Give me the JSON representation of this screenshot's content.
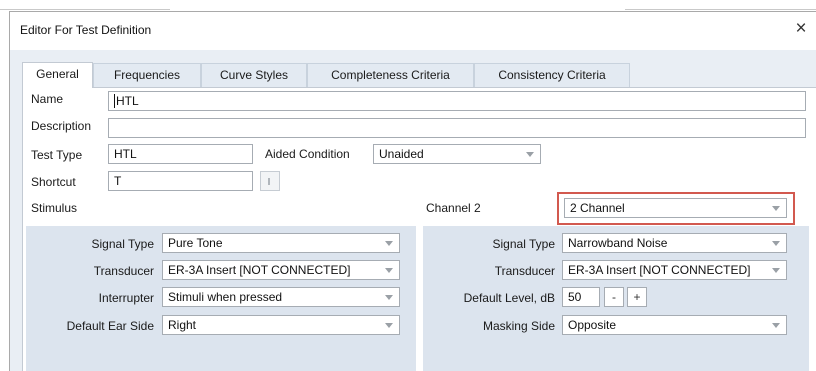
{
  "window": {
    "title": "Editor For Test Definition",
    "close_glyph": "×"
  },
  "tabs": [
    {
      "label": "General",
      "active": true
    },
    {
      "label": "Frequencies",
      "active": false
    },
    {
      "label": "Curve Styles",
      "active": false
    },
    {
      "label": "Completeness Criteria",
      "active": false
    },
    {
      "label": "Consistency Criteria",
      "active": false
    }
  ],
  "general": {
    "name_label": "Name",
    "name_value": "HTL",
    "description_label": "Description",
    "description_value": "",
    "test_type_label": "Test Type",
    "test_type_value": "HTL",
    "aided_condition_label": "Aided Condition",
    "aided_condition_value": "Unaided",
    "shortcut_label": "Shortcut",
    "shortcut_value": "T"
  },
  "stimulus": {
    "section_label": "Stimulus",
    "signal_type_label": "Signal Type",
    "signal_type_value": "Pure Tone",
    "transducer_label": "Transducer",
    "transducer_value": "ER-3A Insert [NOT CONNECTED]",
    "interrupter_label": "Interrupter",
    "interrupter_value": "Stimuli when pressed",
    "default_ear_side_label": "Default Ear Side",
    "default_ear_side_value": "Right"
  },
  "channel2": {
    "section_label": "Channel 2",
    "mode_value": "2 Channel",
    "signal_type_label": "Signal Type",
    "signal_type_value": "Narrowband Noise",
    "transducer_label": "Transducer",
    "transducer_value": "ER-3A Insert [NOT CONNECTED]",
    "default_level_label": "Default Level, dB",
    "default_level_value": "50",
    "decrement_label": "-",
    "increment_label": "+",
    "masking_side_label": "Masking Side",
    "masking_side_value": "Opposite"
  },
  "colors": {
    "highlight": "#d2594f",
    "section_bg": "#dce4ee",
    "tab_strip_bg": "#e9eef4"
  }
}
